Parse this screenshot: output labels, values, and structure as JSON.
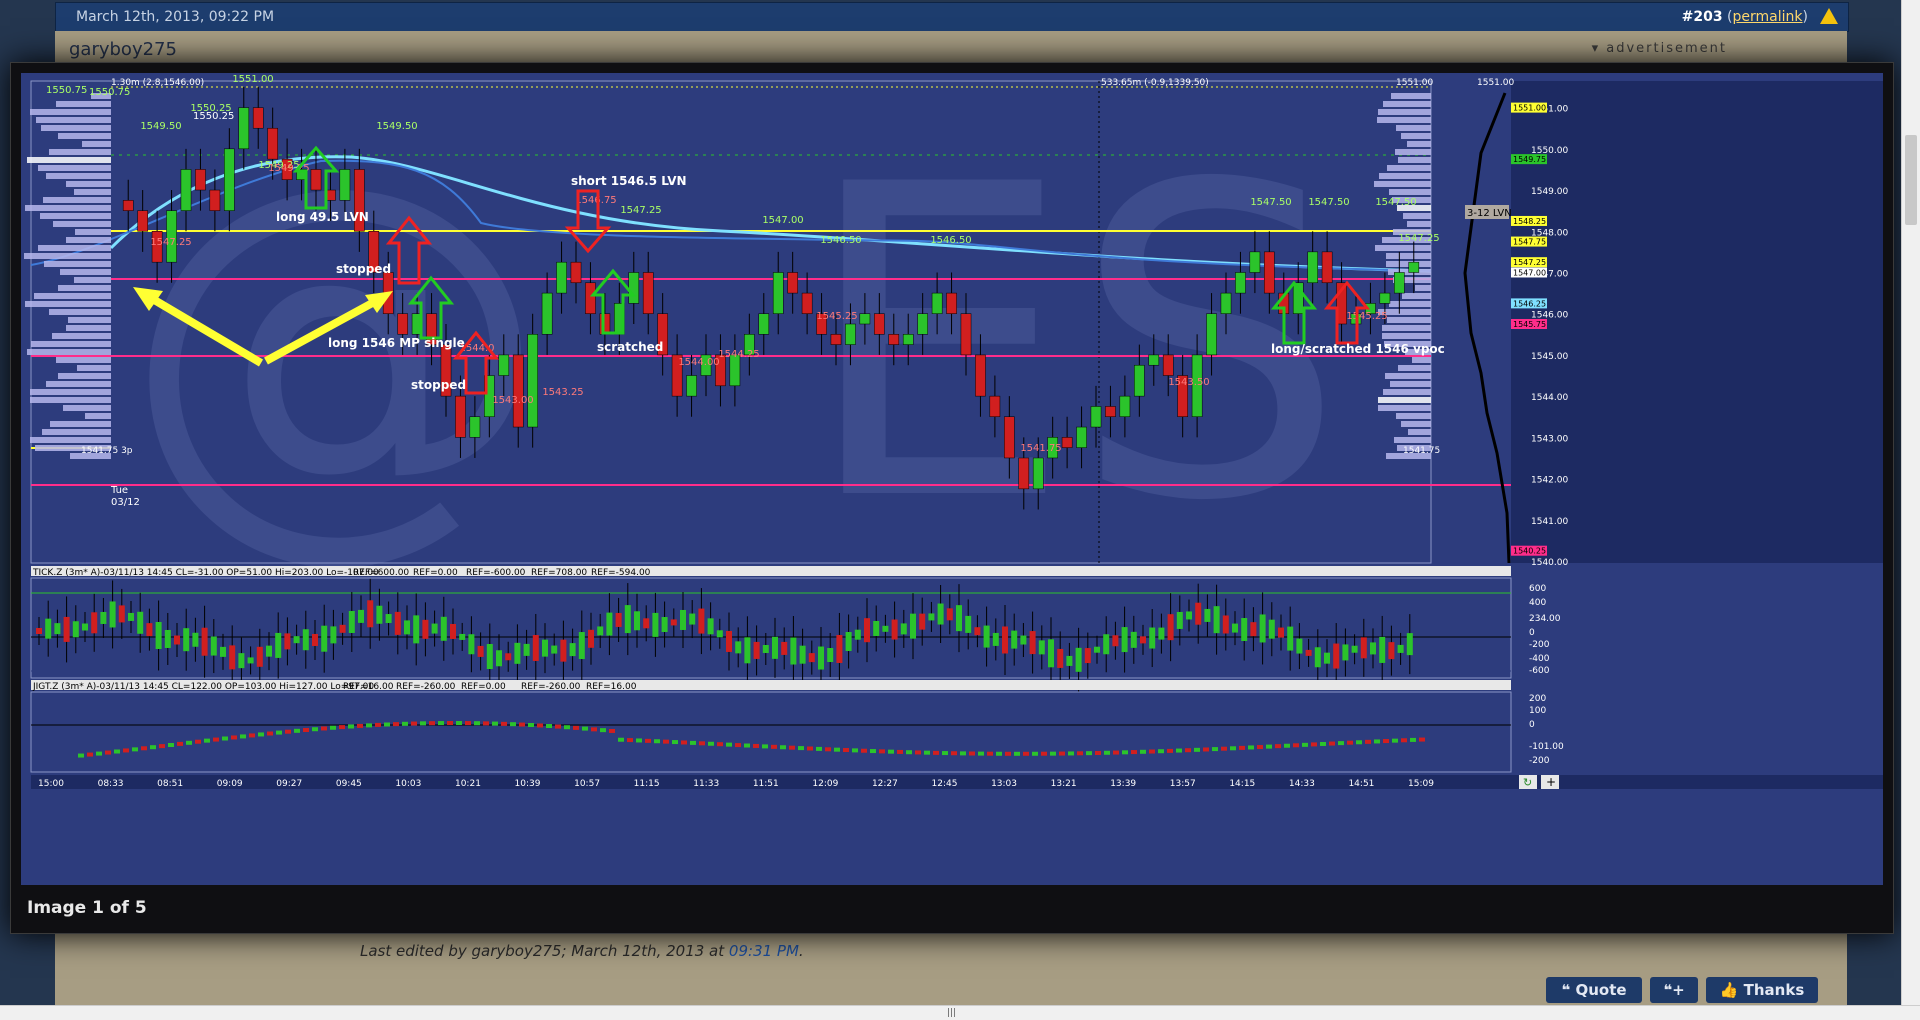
{
  "post": {
    "date": "March 12th, 2013, 09:22 PM",
    "number": "#203",
    "permalink": "permalink",
    "username": "garyboy275",
    "advertisement": "advertisement"
  },
  "lightbox": {
    "caption": "Image 1 of 5"
  },
  "edit_note": {
    "prefix": "Last edited by garyboy275; March 12th, 2013 at",
    "time": "09:31 PM",
    "suffix": "."
  },
  "buttons": {
    "quote": "Quote",
    "thanks": "Thanks"
  },
  "icons": {
    "warning": "warning-icon",
    "multiquote": "multiquote-icon",
    "thanks": "thumbs-up-icon",
    "refresh": "refresh-icon",
    "zoom": "plus-icon"
  },
  "colors": {
    "chart_bg": "#2d3c7d",
    "up": "#2bc42b",
    "down": "#d11f1f",
    "vwap": "#7fe0ff",
    "level": "#ffff33",
    "mp_single": "#ff2d8a",
    "profile": "#b7b7ec"
  },
  "chart_data": {
    "type": "candlestick",
    "symbol_price": "ES",
    "top_labels": [
      "1.30m (2.8,1546.00)",
      "533.65m (-0.9,1339.50)",
      "1551.00",
      "1551.00"
    ],
    "y_ticks": [
      "1551.00",
      "1550.00",
      "1549.00",
      "1548.00",
      "1547.00",
      "1546.00",
      "1545.00",
      "1544.00",
      "1543.00",
      "1542.00",
      "1541.00",
      "1540.00"
    ],
    "ylim": [
      1540,
      1551.5
    ],
    "right_markers": [
      "1551.00",
      "1549.75",
      "1548.25",
      "1547.75",
      "1547.25",
      "1547.00",
      "1546.25",
      "1545.75",
      "1540.25"
    ],
    "lvn_label": "3-12 LVN",
    "date_label": [
      "Tue",
      "03/12"
    ],
    "left_labels": [
      "1550.75",
      "1550.75",
      "1550.25",
      "1541.75 3p",
      "1541.75"
    ],
    "x_ticks": [
      "15:00",
      "08:33",
      "08:51",
      "09:09",
      "09:27",
      "09:45",
      "10:03",
      "10:21",
      "10:39",
      "10:57",
      "11:15",
      "11:33",
      "11:51",
      "12:09",
      "12:27",
      "12:45",
      "13:03",
      "13:21",
      "13:39",
      "13:57",
      "14:15",
      "14:33",
      "14:51",
      "15:09"
    ],
    "close": [
      1548.5,
      1548.0,
      1547.25,
      1548.5,
      1549.5,
      1549.0,
      1548.5,
      1550.0,
      1551.0,
      1550.5,
      1549.75,
      1549.25,
      1549.5,
      1549.0,
      1548.75,
      1549.5,
      1548.0,
      1547.0,
      1546.0,
      1545.5,
      1546.0,
      1545.25,
      1544.0,
      1543.0,
      1543.5,
      1544.5,
      1545.0,
      1543.25,
      1545.5,
      1546.5,
      1547.25,
      1546.75,
      1546.0,
      1545.5,
      1546.25,
      1547.0,
      1546.0,
      1545.0,
      1544.0,
      1544.5,
      1545.0,
      1544.25,
      1545.0,
      1545.5,
      1546.0,
      1547.0,
      1546.5,
      1546.0,
      1545.5,
      1545.25,
      1545.75,
      1546.0,
      1545.5,
      1545.25,
      1545.5,
      1546.0,
      1546.5,
      1546.0,
      1545.0,
      1544.0,
      1543.5,
      1542.5,
      1541.75,
      1542.5,
      1543.0,
      1542.75,
      1543.25,
      1543.75,
      1543.5,
      1544.0,
      1544.75,
      1545.0,
      1544.5,
      1543.5,
      1545.0,
      1546.0,
      1546.5,
      1547.0,
      1547.5,
      1546.5,
      1546.0,
      1546.75,
      1547.5,
      1546.75,
      1545.75,
      1546.0,
      1546.25,
      1546.5,
      1547.0,
      1547.25
    ],
    "annotations_top": [
      "1549.50",
      "1549.50",
      "1551.00",
      "1550.25",
      "1547.25",
      "1547.00",
      "1546.50",
      "1546.50",
      "1547.50",
      "1547.50",
      "1547.50",
      "1549.25",
      "1547.25"
    ],
    "annotations_low": [
      "1547.25",
      "1549.25",
      "1544.0",
      "1543.00",
      "1543.25",
      "1544.00",
      "1544.25",
      "1545.25",
      "1541.75",
      "1543.50",
      "1545.25",
      "1546.75"
    ],
    "trade_notes": [
      "long 49.5 LVN",
      "stopped",
      "short 1546.5 LVN",
      "scratched",
      "long 1546 MP single",
      "stopped",
      "long/scratched 1546 vpoc"
    ],
    "tick_header": [
      "TICK.Z (3m* A)-03/11/13 14:45 CL=-31.00 OP=51.00 Hi=203.00 Lo=-107.00",
      "REF=600.00",
      "REF=0.00",
      "REF=-600.00",
      "REF=708.00",
      "REF=-594.00"
    ],
    "tick_y_ticks": [
      "600",
      "400",
      "234.00",
      "0",
      "-200",
      "-400",
      "-600"
    ],
    "jigt_header": [
      "JIGT.Z (3m* A)-03/11/13 14:45 CL=122.00 OP=103.00 Hi=127.00 Lo=97.00",
      "REF=16.00",
      "REF=-260.00",
      "REF=0.00",
      "REF=-260.00",
      "REF=16.00"
    ],
    "jigt_y_ticks": [
      "200",
      "100",
      "0",
      "-101.00",
      "-200"
    ],
    "sub_left": [
      "000",
      "000 v",
      "00",
      "0",
      "00 v"
    ]
  }
}
